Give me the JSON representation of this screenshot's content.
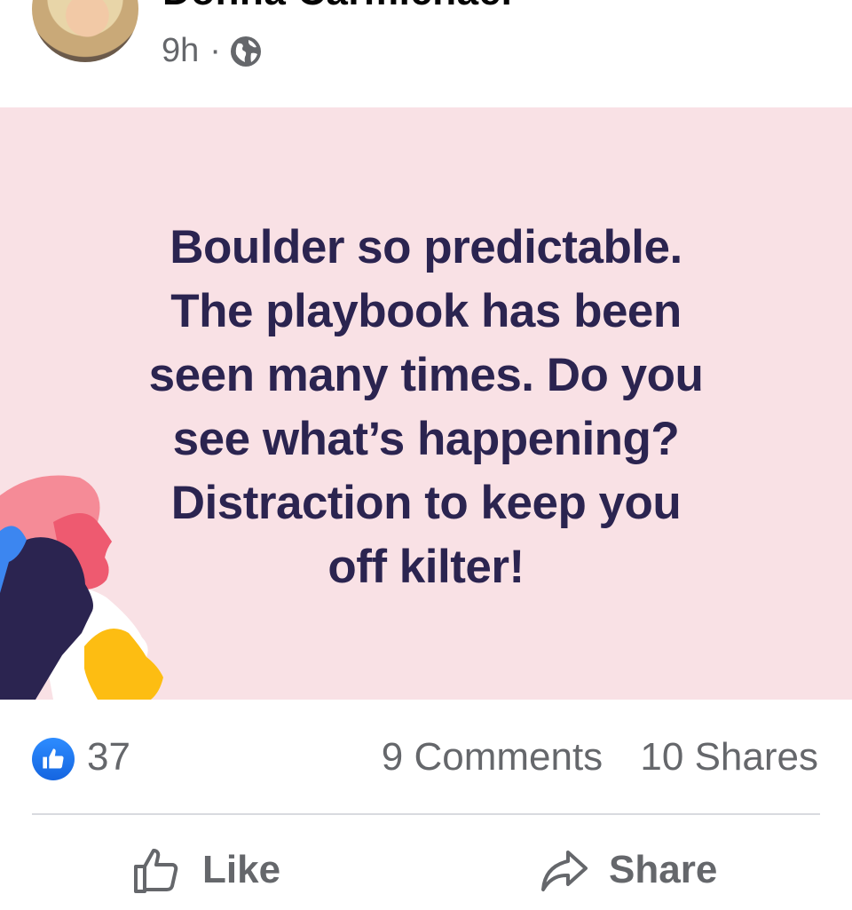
{
  "post": {
    "author": "Donna Carmichael",
    "time": "9h",
    "separator": "·",
    "privacy_icon": "globe-icon",
    "text": "Boulder so predictable.\nThe playbook has been\nseen many times.  Do you\nsee what’s happening?\nDistraction to keep you\noff kilter!",
    "background_color": "#f9e1e5",
    "text_color": "#2b2450"
  },
  "stats": {
    "reaction_icon": "thumbs-up-icon",
    "likes": "37",
    "comments": "9 Comments",
    "shares": "10 Shares"
  },
  "actions": {
    "like_label": "Like",
    "share_label": "Share"
  }
}
